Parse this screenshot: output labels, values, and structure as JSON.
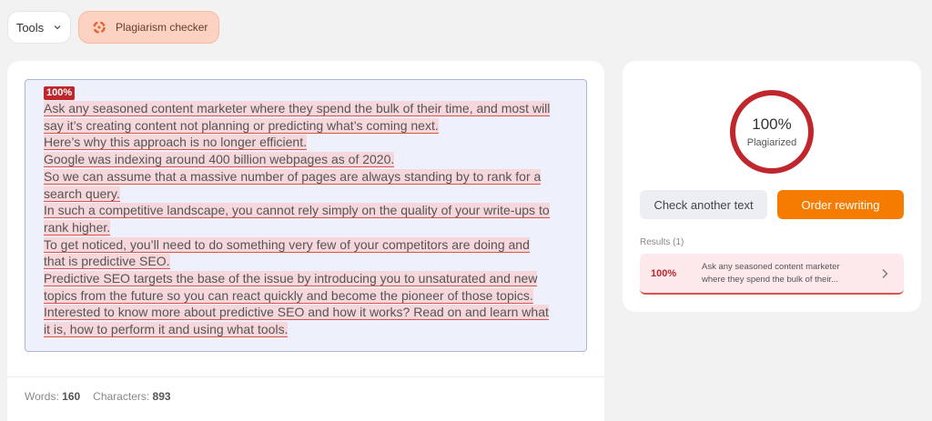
{
  "topbar": {
    "tools_label": "Tools",
    "tool_name": "Plagiarism checker"
  },
  "editor": {
    "match_percent": "100%",
    "sentences": [
      "Ask any seasoned content marketer where they spend the bulk of their time, and most will say it’s creating content not planning or predicting what’s coming next.",
      "Here’s why this approach is no longer efficient.",
      "Google was indexing around 400 billion webpages as of 2020.",
      "So we can assume that a massive number of pages are always standing by to rank for a search query.",
      "In such a competitive landscape, you cannot rely simply on the quality of your write-ups to rank higher.",
      "To get noticed, you’ll need to do something very few of your competitors are doing and that is predictive SEO.",
      "Predictive SEO targets the base of the issue by introducing you to unsaturated and new topics from the future so you can react quickly and become the pioneer of those topics.",
      "Interested to know more about predictive SEO and how it works? Read on and learn what it is, how to perform it and using what tools."
    ],
    "words_label": "Words:",
    "words_value": "160",
    "chars_label": "Characters:",
    "chars_value": "893"
  },
  "result": {
    "score": "100%",
    "score_label": "Plagiarized",
    "score_fraction": 1.0,
    "check_another_label": "Check another text",
    "order_rewriting_label": "Order rewriting",
    "results_heading": "Results (1)",
    "items": [
      {
        "percent": "100%",
        "snippet": "Ask any seasoned content marketer where they spend the bulk of their..."
      }
    ]
  },
  "colors": {
    "accent_orange": "#f57c00",
    "danger_red": "#c0272d",
    "highlight_pink": "#f6d7dc"
  }
}
